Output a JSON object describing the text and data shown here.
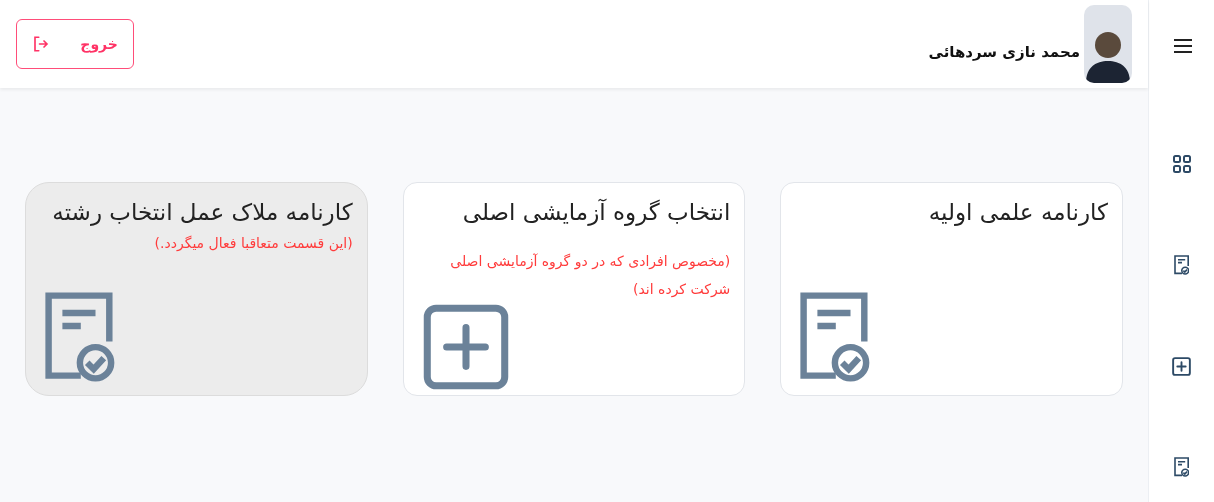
{
  "header": {
    "user_name": "محمد نازی سردهائی",
    "logout_label": "خروج"
  },
  "sidebar": {
    "items": [
      {
        "kind": "grid"
      },
      {
        "kind": "report"
      },
      {
        "kind": "plus"
      },
      {
        "kind": "report"
      }
    ]
  },
  "cards": [
    {
      "title": "کارنامه علمی اولیه",
      "kind": "report",
      "disabled": false
    },
    {
      "title": "انتخاب گروه آزمایشی اصلی",
      "note": "(مخصوص افرادی که در دو گروه آزمایشی اصلی شرکت کرده اند)",
      "kind": "plus",
      "disabled": false
    },
    {
      "title": "کارنامه ملاک عمل انتخاب رشته",
      "note": "(این قسمت متعاقبا فعال میگردد.)",
      "kind": "report",
      "disabled": true
    }
  ]
}
